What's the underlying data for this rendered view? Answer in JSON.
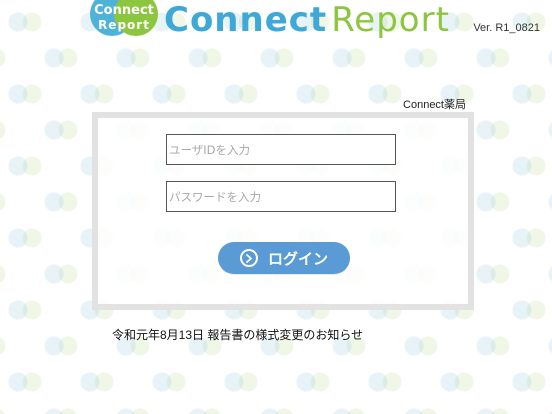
{
  "header": {
    "badge_line1": "Connect",
    "badge_line2": "Report",
    "title_part1": "Connect",
    "title_part2": "Report",
    "version": "Ver. R1_0821"
  },
  "pharmacy_name": "Connect薬局",
  "login_form": {
    "user_id_placeholder": "ユーザIDを入力",
    "user_id_value": "",
    "password_placeholder": "パスワードを入力",
    "password_value": "",
    "login_label": "ログイン"
  },
  "notice": "令和元年8月13日 報告書の様式変更のお知らせ",
  "colors": {
    "brand_blue": "#3ea9d6",
    "brand_green": "#8cc63f",
    "button_blue": "#5a9bd6",
    "panel_border": "#e2e2e2"
  },
  "icons": {
    "login": "chevron-right-circle-icon"
  }
}
